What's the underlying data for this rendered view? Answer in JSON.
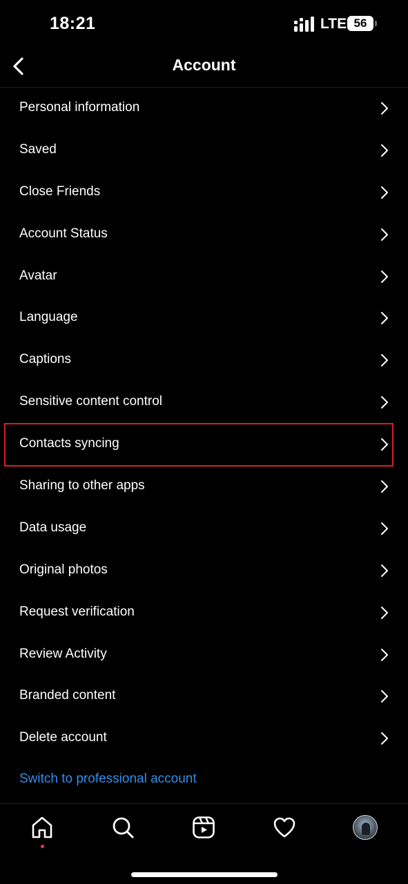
{
  "status_bar": {
    "time": "18:21",
    "network": "LTE",
    "battery": "56"
  },
  "header": {
    "title": "Account",
    "back_icon": "chevron-left-icon"
  },
  "menu": {
    "items": [
      {
        "label": "Personal information"
      },
      {
        "label": "Saved"
      },
      {
        "label": "Close Friends"
      },
      {
        "label": "Account Status"
      },
      {
        "label": "Avatar"
      },
      {
        "label": "Language"
      },
      {
        "label": "Captions"
      },
      {
        "label": "Sensitive content control"
      },
      {
        "label": "Contacts syncing",
        "highlighted": true
      },
      {
        "label": "Sharing to other apps"
      },
      {
        "label": "Data usage"
      },
      {
        "label": "Original photos"
      },
      {
        "label": "Request verification"
      },
      {
        "label": "Review Activity"
      },
      {
        "label": "Branded content"
      },
      {
        "label": "Delete account"
      }
    ],
    "chevron_icon": "chevron-right-icon"
  },
  "switch_link": {
    "label": "Switch to professional account",
    "color": "#2d8ff0"
  },
  "bottom_nav": {
    "items": [
      {
        "icon": "home-icon",
        "active": true
      },
      {
        "icon": "search-icon"
      },
      {
        "icon": "reels-icon"
      },
      {
        "icon": "heart-icon"
      },
      {
        "icon": "profile-avatar"
      }
    ],
    "notification_dot_color": "#ff2d55"
  },
  "colors": {
    "background": "#000000",
    "text": "#ffffff",
    "highlight_border": "#e11b22",
    "link": "#2d8ff0"
  }
}
